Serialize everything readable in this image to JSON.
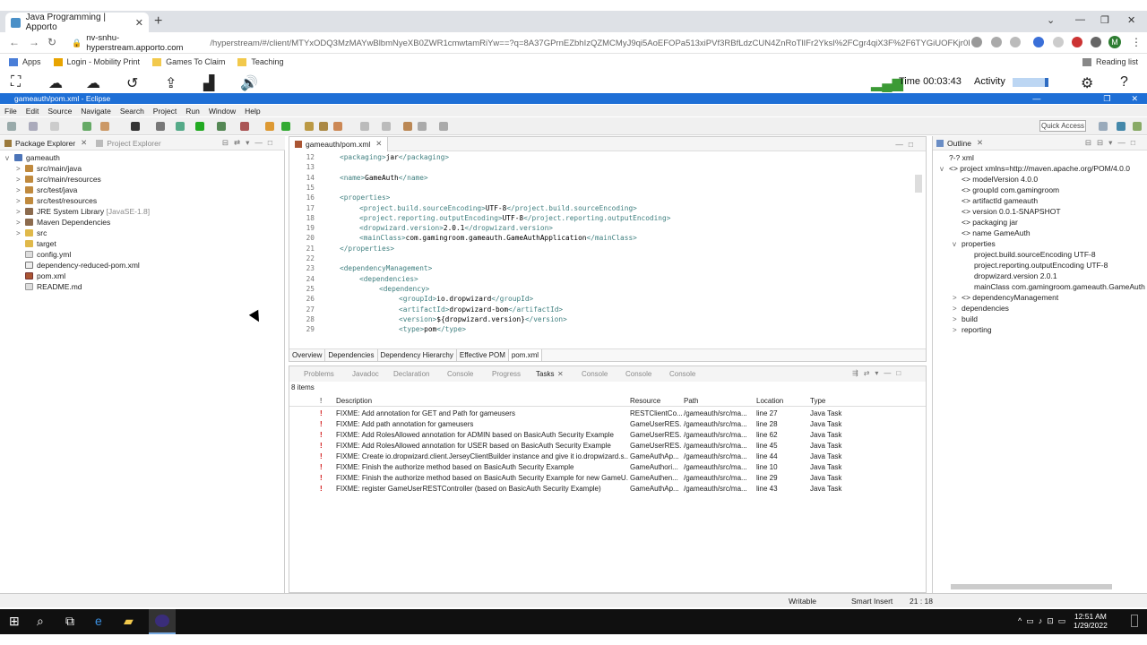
{
  "browser": {
    "tab_title": "Java Programming | Apporto",
    "url_domain": "nv-snhu-hyperstream.apporto.com",
    "url_rest": "/hyperstream/#/client/MTYxODQ3MzMAYwBlbmNyeXB0ZWR1cmwtamRiYw==?q=8A37GPrnEZbhIzQZMCMyJ9qi5AoEFOPa513xiPVf3RBfLdzCUN4ZnRoTlIFr2YksI%2FCgr4qiX3F%2F6TYGiUOFKjr0Efmov G...",
    "bookmarks": [
      "Apps",
      "Login - Mobility Print",
      "Games To Claim",
      "Teaching"
    ],
    "reading_list": "Reading list",
    "profile_initial": "M"
  },
  "apporto": {
    "time": "Time 00:03:43",
    "activity": "Activity"
  },
  "eclipse": {
    "title": "gameauth/pom.xml - Eclipse",
    "menus": [
      "File",
      "Edit",
      "Source",
      "Navigate",
      "Search",
      "Project",
      "Run",
      "Window",
      "Help"
    ],
    "quick_access": "Quick Access"
  },
  "package_explorer": {
    "tab": "Package Explorer",
    "tab2": "Project Explorer",
    "items": [
      {
        "label": "gameauth",
        "extra": ""
      },
      {
        "label": "src/main/java",
        "extra": ""
      },
      {
        "label": "src/main/resources",
        "extra": ""
      },
      {
        "label": "src/test/java",
        "extra": ""
      },
      {
        "label": "src/test/resources",
        "extra": ""
      },
      {
        "label": "JRE System Library",
        "extra": "[JavaSE-1.8]"
      },
      {
        "label": "Maven Dependencies",
        "extra": ""
      },
      {
        "label": "src",
        "extra": ""
      },
      {
        "label": "target",
        "extra": ""
      },
      {
        "label": "config.yml",
        "extra": ""
      },
      {
        "label": "dependency-reduced-pom.xml",
        "extra": ""
      },
      {
        "label": "pom.xml",
        "extra": ""
      },
      {
        "label": "README.md",
        "extra": ""
      }
    ]
  },
  "editor": {
    "tab": "gameauth/pom.xml",
    "lines": [
      {
        "n": "12",
        "indent": 0,
        "open": "<packaging>",
        "text": "jar",
        "close": "</packaging>"
      },
      {
        "n": "13",
        "indent": 0,
        "open": "",
        "text": "",
        "close": ""
      },
      {
        "n": "14",
        "indent": 0,
        "open": "<name>",
        "text": "GameAuth",
        "close": "</name>"
      },
      {
        "n": "15",
        "indent": 0,
        "open": "",
        "text": "",
        "close": ""
      },
      {
        "n": "16",
        "indent": 0,
        "open": "<properties>",
        "text": "",
        "close": ""
      },
      {
        "n": "17",
        "indent": 1,
        "open": "<project.build.sourceEncoding>",
        "text": "UTF-8",
        "close": "</project.build.sourceEncoding>"
      },
      {
        "n": "18",
        "indent": 1,
        "open": "<project.reporting.outputEncoding>",
        "text": "UTF-8",
        "close": "</project.reporting.outputEncoding>"
      },
      {
        "n": "19",
        "indent": 1,
        "open": "<dropwizard.version>",
        "text": "2.0.1",
        "close": "</dropwizard.version>"
      },
      {
        "n": "20",
        "indent": 1,
        "open": "<mainClass>",
        "text": "com.gamingroom.gameauth.GameAuthApplication",
        "close": "</mainClass>"
      },
      {
        "n": "21",
        "indent": 0,
        "open": "</properties>",
        "text": "",
        "close": ""
      },
      {
        "n": "22",
        "indent": 0,
        "open": "",
        "text": "",
        "close": ""
      },
      {
        "n": "23",
        "indent": 0,
        "open": "<dependencyManagement>",
        "text": "",
        "close": ""
      },
      {
        "n": "24",
        "indent": 1,
        "open": "<dependencies>",
        "text": "",
        "close": ""
      },
      {
        "n": "25",
        "indent": 2,
        "open": "<dependency>",
        "text": "",
        "close": ""
      },
      {
        "n": "26",
        "indent": 3,
        "open": "<groupId>",
        "text": "io.dropwizard",
        "close": "</groupId>"
      },
      {
        "n": "27",
        "indent": 3,
        "open": "<artifactId>",
        "text": "dropwizard-bom",
        "close": "</artifactId>"
      },
      {
        "n": "28",
        "indent": 3,
        "open": "<version>",
        "text": "${dropwizard.version}",
        "close": "</version>"
      },
      {
        "n": "29",
        "indent": 3,
        "open": "<type>",
        "text": "pom",
        "close": "</type>"
      }
    ],
    "bottom_tabs": [
      "Overview",
      "Dependencies",
      "Dependency Hierarchy",
      "Effective POM",
      "pom.xml"
    ]
  },
  "tasks": {
    "tabs": [
      "Problems",
      "Javadoc",
      "Declaration",
      "Console",
      "Progress",
      "Tasks",
      "Console",
      "Console",
      "Console"
    ],
    "count": "8 items",
    "headers": [
      "!",
      "Description",
      "Resource",
      "Path",
      "Location",
      "Type"
    ],
    "rows": [
      {
        "d": "FIXME: Add annotation for GET and Path for gameusers",
        "r": "RESTClientCo...",
        "p": "/gameauth/src/ma...",
        "l": "line 27",
        "t": "Java Task"
      },
      {
        "d": "FIXME: Add path annotation for gameusers",
        "r": "GameUserRES...",
        "p": "/gameauth/src/ma...",
        "l": "line 28",
        "t": "Java Task"
      },
      {
        "d": "FIXME: Add RolesAllowed annotation for ADMIN based on BasicAuth Security Example",
        "r": "GameUserRES...",
        "p": "/gameauth/src/ma...",
        "l": "line 62",
        "t": "Java Task"
      },
      {
        "d": "FIXME: Add RolesAllowed annotation for USER based on BasicAuth Security Example",
        "r": "GameUserRES...",
        "p": "/gameauth/src/ma...",
        "l": "line 45",
        "t": "Java Task"
      },
      {
        "d": "FIXME: Create io.dropwizard.client.JerseyClientBuilder instance and give it io.dropwizard.s...",
        "r": "GameAuthAp...",
        "p": "/gameauth/src/ma...",
        "l": "line 44",
        "t": "Java Task"
      },
      {
        "d": "FIXME: Finish the authorize method based on BasicAuth Security Example",
        "r": "GameAuthori...",
        "p": "/gameauth/src/ma...",
        "l": "line 10",
        "t": "Java Task"
      },
      {
        "d": "FIXME: Finish the authorize method based on BasicAuth Security Example for new GameU...",
        "r": "GameAuthen...",
        "p": "/gameauth/src/ma...",
        "l": "line 29",
        "t": "Java Task"
      },
      {
        "d": "FIXME: register GameUserRESTController (based on BasicAuth Security Example)",
        "r": "GameAuthAp...",
        "p": "/gameauth/src/ma...",
        "l": "line 43",
        "t": "Java Task"
      }
    ]
  },
  "outline": {
    "tab": "Outline",
    "items": [
      {
        "label": "?-? xml",
        "level": 0,
        "tw": ""
      },
      {
        "label": "<> project xmlns=http://maven.apache.org/POM/4.0.0",
        "level": 0,
        "tw": "v"
      },
      {
        "label": "<> modelVersion  4.0.0",
        "level": 1,
        "tw": ""
      },
      {
        "label": "<> groupId  com.gamingroom",
        "level": 1,
        "tw": ""
      },
      {
        "label": "<> artifactId  gameauth",
        "level": 1,
        "tw": ""
      },
      {
        "label": "<> version  0.0.1-SNAPSHOT",
        "level": 1,
        "tw": ""
      },
      {
        "label": "<> packaging  jar",
        "level": 1,
        "tw": ""
      },
      {
        "label": "<> name  GameAuth",
        "level": 1,
        "tw": ""
      },
      {
        "label": "properties",
        "level": 1,
        "tw": "v"
      },
      {
        "label": "project.build.sourceEncoding  UTF-8",
        "level": 2,
        "tw": ""
      },
      {
        "label": "project.reporting.outputEncoding  UTF-8",
        "level": 2,
        "tw": ""
      },
      {
        "label": "dropwizard.version  2.0.1",
        "level": 2,
        "tw": ""
      },
      {
        "label": "mainClass  com.gamingroom.gameauth.GameAuth",
        "level": 2,
        "tw": ""
      },
      {
        "label": "<> dependencyManagement",
        "level": 1,
        "tw": ">"
      },
      {
        "label": "dependencies",
        "level": 1,
        "tw": ">"
      },
      {
        "label": "build",
        "level": 1,
        "tw": ">"
      },
      {
        "label": "reporting",
        "level": 1,
        "tw": ">"
      }
    ]
  },
  "statusbar": {
    "writable": "Writable",
    "insert": "Smart Insert",
    "pos": "21 : 18"
  },
  "taskbar": {
    "time": "12:51 AM",
    "date": "1/29/2022"
  }
}
